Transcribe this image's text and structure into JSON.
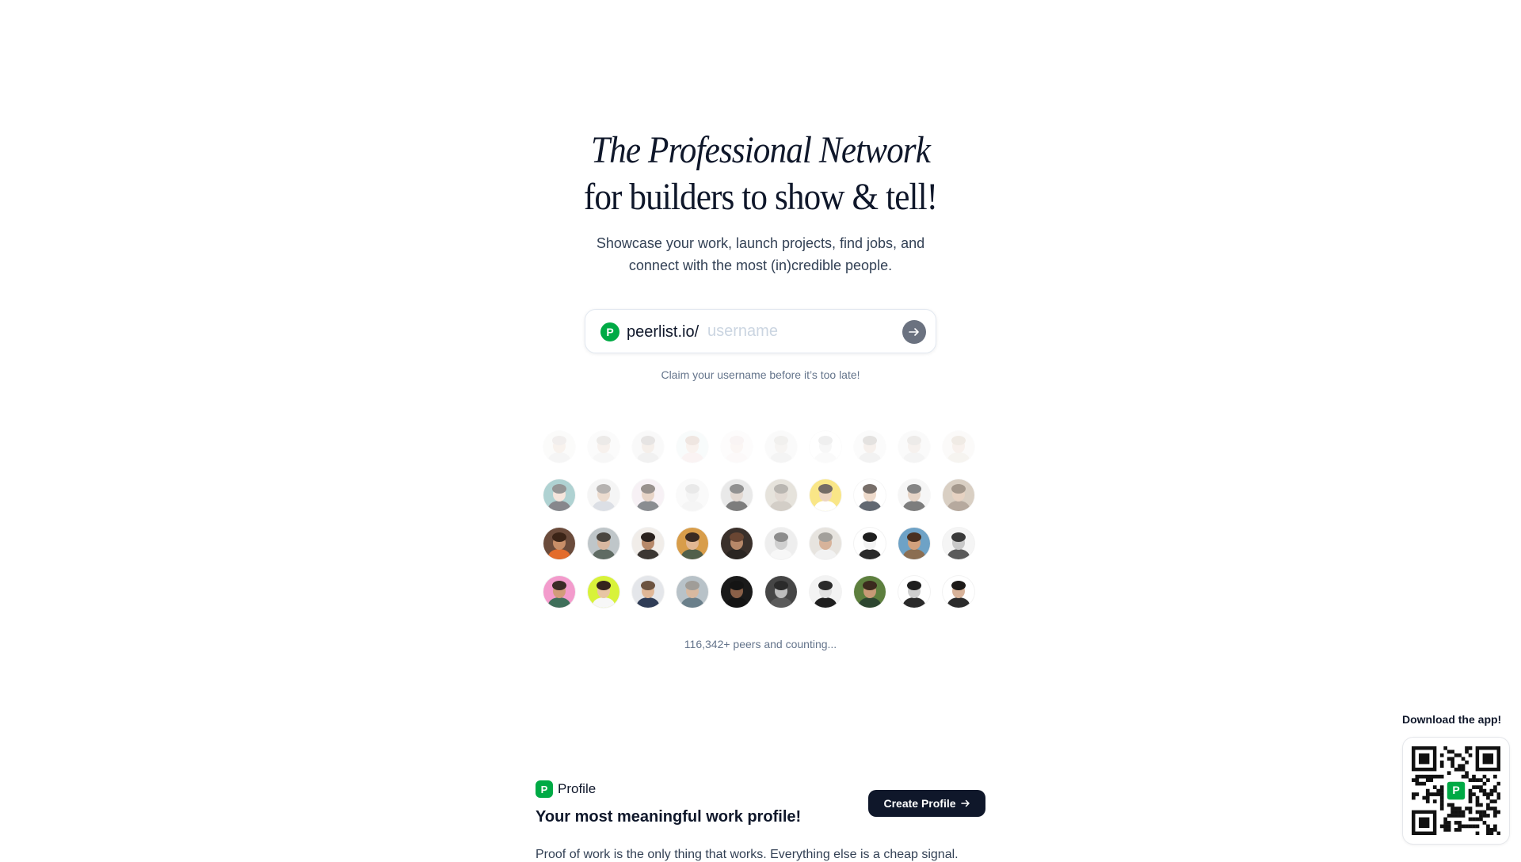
{
  "hero": {
    "title_line1": "The Professional Network",
    "title_line2": "for builders to show & tell!",
    "subtitle": "Showcase your work, launch projects, find jobs, and connect with the most (in)credible people."
  },
  "claim": {
    "logo_letter": "P",
    "prefix": "peerlist.io/",
    "placeholder": "username",
    "submit_icon": "arrow-right-icon",
    "hint": "Claim your username before it’s too late!"
  },
  "avatars": {
    "count_text": "116,342+ peers and counting...",
    "rows": [
      [
        {
          "bg": "#f1f1ef",
          "skin": "#e9d2c0",
          "hair": "#cfc6bf",
          "shirt": "#dcdcdc",
          "faded": 0.28
        },
        {
          "bg": "#f2f2f2",
          "skin": "#e6cfc1",
          "hair": "#bdb5af",
          "shirt": "#e3e3e3",
          "faded": 0.28
        },
        {
          "bg": "#ececec",
          "skin": "#dcc7b7",
          "hair": "#a8a29e",
          "shirt": "#cfcfcf",
          "faded": 0.28
        },
        {
          "bg": "#e8f1f3",
          "skin": "#edd3c3",
          "hair": "#c7a797",
          "shirt": "#f0d6d6",
          "faded": 0.28
        },
        {
          "bg": "#f7f3f3",
          "skin": "#f1d9d1",
          "hair": "#e5cfcf",
          "shirt": "#f2e7e7",
          "faded": 0.22
        },
        {
          "bg": "#efefef",
          "skin": "#e2dad4",
          "hair": "#cfcac5",
          "shirt": "#d8d8d8",
          "faded": 0.28
        },
        {
          "bg": "#ffffff",
          "skin": "#e6e6e6",
          "hair": "#c9c9c9",
          "shirt": "#efefef",
          "faded": 0.28
        },
        {
          "bg": "#f1f1f1",
          "skin": "#e2cbbd",
          "hair": "#9f9893",
          "shirt": "#d2d2d2",
          "faded": 0.28
        },
        {
          "bg": "#eeeeee",
          "skin": "#dfd0c4",
          "hair": "#c0b8b1",
          "shirt": "#d9d9d9",
          "faded": 0.28
        },
        {
          "bg": "#f2efea",
          "skin": "#e7cfbf",
          "hair": "#cdb9a5",
          "shirt": "#e2d8cc",
          "faded": 0.28
        }
      ],
      [
        {
          "bg": "#7fb8b7",
          "skin": "#efd6c7",
          "hair": "#555555",
          "shirt": "#3f3f46",
          "faded": 0.62
        },
        {
          "bg": "#f0f0f0",
          "skin": "#e2c7b3",
          "hair": "#8a8582",
          "shirt": "#c7ccd6",
          "faded": 0.62
        },
        {
          "bg": "#f3e9ef",
          "skin": "#d9bba6",
          "hair": "#5b504a",
          "shirt": "#43484f",
          "faded": 0.62
        },
        {
          "bg": "#f4f4f4",
          "skin": "#e8e8e8",
          "hair": "#d0d0d0",
          "shirt": "#eaeaea",
          "faded": 0.45
        },
        {
          "bg": "#dcdcdc",
          "skin": "#d1c1b6",
          "hair": "#4f4f4f",
          "shirt": "#2f2f2f",
          "faded": 0.62
        },
        {
          "bg": "#d8d2c8",
          "skin": "#cfc3b7",
          "hair": "#8f8a83",
          "shirt": "#b9b1a6",
          "faded": 0.62
        },
        {
          "bg": "#f7dc55",
          "skin": "#e6c4a8",
          "hair": "#3a2d25",
          "shirt": "#ffffff",
          "faded": 0.7
        },
        {
          "bg": "#ffffff",
          "skin": "#e7cbb6",
          "hair": "#3f332c",
          "shirt": "#1f2937",
          "faded": 0.7
        },
        {
          "bg": "#f2f2f2",
          "skin": "#d9bca5",
          "hair": "#3b3b3b",
          "shirt": "#2e2e2e",
          "faded": 0.62
        },
        {
          "bg": "#c2b29f",
          "skin": "#d7b89e",
          "hair": "#6e5a47",
          "shirt": "#8a7563",
          "faded": 0.62
        }
      ],
      [
        {
          "bg": "#6b4b3b",
          "skin": "#c88e68",
          "hair": "#3b2417",
          "shirt": "#e36c2c",
          "faded": 1
        },
        {
          "bg": "#bfc6c9",
          "skin": "#d8b8a1",
          "hair": "#4a4640",
          "shirt": "#5f6b63",
          "faded": 1
        },
        {
          "bg": "#f1ede9",
          "skin": "#b7896a",
          "hair": "#2b221e",
          "shirt": "#3c3733",
          "faded": 1
        },
        {
          "bg": "#d89d4a",
          "skin": "#e2b792",
          "hair": "#3a2b22",
          "shirt": "#51604a",
          "faded": 1
        },
        {
          "bg": "#3a302b",
          "skin": "#b78869",
          "hair": "#6a4633",
          "shirt": "#2a2522",
          "faded": 1
        },
        {
          "bg": "#eeeeee",
          "skin": "#cfcfcf",
          "hair": "#8c8c8c",
          "shirt": "#f7f7f7",
          "faded": 1
        },
        {
          "bg": "#e7e4df",
          "skin": "#d7b39a",
          "hair": "#a3a09b",
          "shirt": "#f2f2f2",
          "faded": 1
        },
        {
          "bg": "#ffffff",
          "skin": "#f3f3f3",
          "hair": "#1f1f1f",
          "shirt": "#2b2b2b",
          "faded": 1
        },
        {
          "bg": "#6ea2c6",
          "skin": "#d2a17d",
          "hair": "#4a3020",
          "shirt": "#8b6e52",
          "faded": 1
        },
        {
          "bg": "#f5f5f5",
          "skin": "#c9c9c9",
          "hair": "#3a3a3a",
          "shirt": "#5a5a5a",
          "faded": 1
        }
      ],
      [
        {
          "bg": "#f39bcc",
          "skin": "#d29c7a",
          "hair": "#3b2b25",
          "shirt": "#3f6f5a",
          "faded": 1
        },
        {
          "bg": "#d8f23a",
          "skin": "#e8c5a4",
          "hair": "#35251d",
          "shirt": "#f7f7f7",
          "faded": 1
        },
        {
          "bg": "#e4e6ea",
          "skin": "#e0b797",
          "hair": "#6c5340",
          "shirt": "#2f3c56",
          "faded": 1
        },
        {
          "bg": "#b8c2c8",
          "skin": "#d8b9a0",
          "hair": "#a09d98",
          "shirt": "#6a7f8a",
          "faded": 1
        },
        {
          "bg": "#1a1a1a",
          "skin": "#8a6048",
          "hair": "#141414",
          "shirt": "#141414",
          "faded": 1
        },
        {
          "bg": "#464646",
          "skin": "#bdbdbd",
          "hair": "#2b2b2b",
          "shirt": "#5a5a5a",
          "faded": 1
        },
        {
          "bg": "#f3f3f3",
          "skin": "#e2e2e2",
          "hair": "#2c2c2c",
          "shirt": "#1f1f1f",
          "faded": 1
        },
        {
          "bg": "#5d7f3e",
          "skin": "#c89a76",
          "hair": "#3b2a1e",
          "shirt": "#2d4630",
          "faded": 1
        },
        {
          "bg": "#ffffff",
          "skin": "#cfcfcf",
          "hair": "#1e1e1e",
          "shirt": "#2a2a2a",
          "faded": 1
        },
        {
          "bg": "#ffffff",
          "skin": "#d8b39a",
          "hair": "#1d1a18",
          "shirt": "#2b2b2b",
          "faded": 1
        }
      ]
    ]
  },
  "profile_section": {
    "logo_letter": "P",
    "label": "Profile",
    "title": "Your most meaningful work profile!",
    "cta": "Create Profile",
    "cta_icon": "arrow-right-icon",
    "text": "Proof of work is the only thing that works. Everything else is a cheap signal."
  },
  "download": {
    "label": "Download the app!",
    "qr_logo_letter": "P"
  },
  "colors": {
    "brand_green": "#00aa45",
    "dark_button": "#0f172a",
    "submit_grey": "#6b7280"
  }
}
